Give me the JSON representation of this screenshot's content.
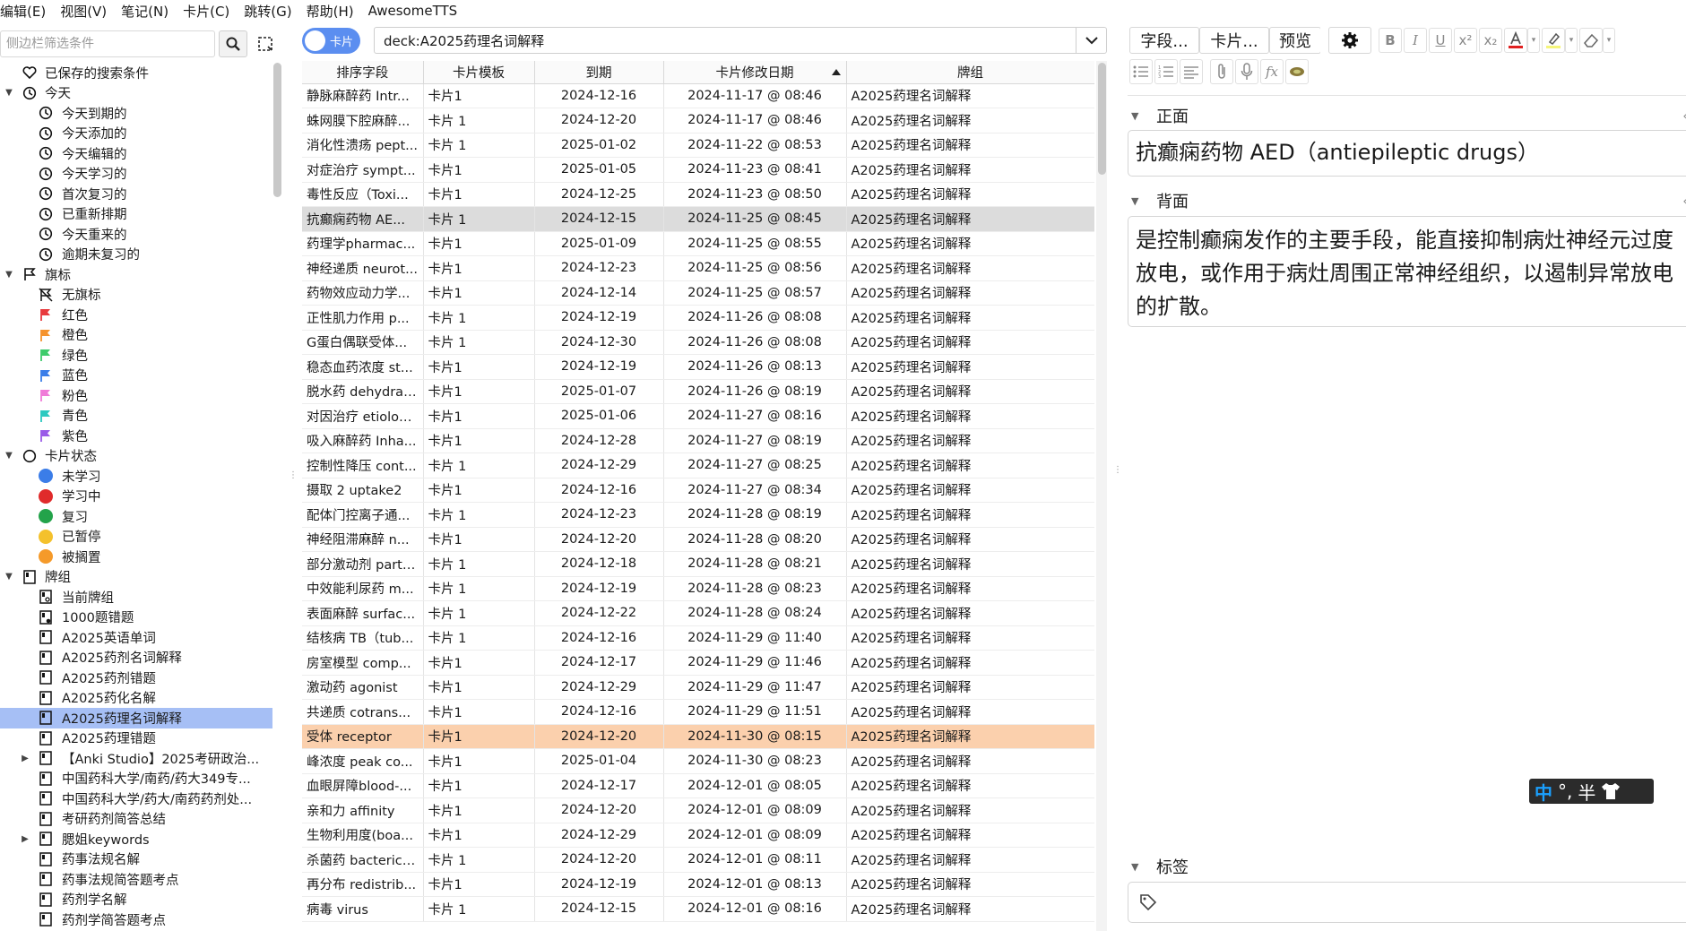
{
  "menu": [
    "编辑(E)",
    "视图(V)",
    "笔记(N)",
    "卡片(C)",
    "跳转(G)",
    "帮助(H)",
    "AwesomeTTS"
  ],
  "sidebar": {
    "search_placeholder": "侧边栏筛选条件",
    "items": [
      {
        "label": "已保存的搜索条件",
        "level": 0,
        "icon": "heart-icon",
        "expander": ""
      },
      {
        "label": "今天",
        "level": 0,
        "icon": "clock-icon",
        "expander": "open"
      },
      {
        "label": "今天到期的",
        "level": 1,
        "icon": "clock-icon",
        "expander": ""
      },
      {
        "label": "今天添加的",
        "level": 1,
        "icon": "clock-icon",
        "expander": ""
      },
      {
        "label": "今天编辑的",
        "level": 1,
        "icon": "clock-icon",
        "expander": ""
      },
      {
        "label": "今天学习的",
        "level": 1,
        "icon": "clock-icon",
        "expander": ""
      },
      {
        "label": "首次复习的",
        "level": 1,
        "icon": "clock-icon",
        "expander": ""
      },
      {
        "label": "已重新排期",
        "level": 1,
        "icon": "clock-icon",
        "expander": ""
      },
      {
        "label": "今天重来的",
        "level": 1,
        "icon": "clock-icon",
        "expander": ""
      },
      {
        "label": "逾期未复习的",
        "level": 1,
        "icon": "clock-icon",
        "expander": ""
      },
      {
        "label": "旗标",
        "level": 0,
        "icon": "flag-outline-icon",
        "expander": "open"
      },
      {
        "label": "无旗标",
        "level": 1,
        "icon": "no-flag-icon",
        "expander": ""
      },
      {
        "label": "红色",
        "level": 1,
        "icon": "flag-red-icon",
        "color": "#e8393c",
        "expander": ""
      },
      {
        "label": "橙色",
        "level": 1,
        "icon": "flag-orange-icon",
        "color": "#f5932e",
        "expander": ""
      },
      {
        "label": "绿色",
        "level": 1,
        "icon": "flag-green-icon",
        "color": "#3ecb6b",
        "expander": ""
      },
      {
        "label": "蓝色",
        "level": 1,
        "icon": "flag-blue-icon",
        "color": "#3b7de8",
        "expander": ""
      },
      {
        "label": "粉色",
        "level": 1,
        "icon": "flag-pink-icon",
        "color": "#f07ad8",
        "expander": ""
      },
      {
        "label": "青色",
        "level": 1,
        "icon": "flag-cyan-icon",
        "color": "#2bc9c0",
        "expander": ""
      },
      {
        "label": "紫色",
        "level": 1,
        "icon": "flag-purple-icon",
        "color": "#9a5be8",
        "expander": ""
      },
      {
        "label": "卡片状态",
        "level": 0,
        "icon": "circle-outline-icon",
        "expander": "open"
      },
      {
        "label": "未学习",
        "level": 1,
        "icon": "dot-blue-icon",
        "color": "#3b7de8",
        "expander": ""
      },
      {
        "label": "学习中",
        "level": 1,
        "icon": "dot-red-icon",
        "color": "#e02b2b",
        "expander": ""
      },
      {
        "label": "复习",
        "level": 1,
        "icon": "dot-green-icon",
        "color": "#23a34a",
        "expander": ""
      },
      {
        "label": "已暂停",
        "level": 1,
        "icon": "dot-yellow-icon",
        "color": "#f4c12c",
        "expander": ""
      },
      {
        "label": "被搁置",
        "level": 1,
        "icon": "dot-orange-icon",
        "color": "#f59a2a",
        "expander": ""
      },
      {
        "label": "牌组",
        "level": 0,
        "icon": "deck-icon",
        "expander": "open"
      },
      {
        "label": "当前牌组",
        "level": 1,
        "icon": "current-deck-icon",
        "expander": ""
      },
      {
        "label": "1000题错题",
        "level": 1,
        "icon": "filtered-deck-icon",
        "expander": ""
      },
      {
        "label": "A2025英语单词",
        "level": 1,
        "icon": "deck-icon",
        "expander": ""
      },
      {
        "label": "A2025药剂名词解释",
        "level": 1,
        "icon": "deck-icon",
        "expander": ""
      },
      {
        "label": "A2025药剂错题",
        "level": 1,
        "icon": "deck-icon",
        "expander": ""
      },
      {
        "label": "A2025药化名解",
        "level": 1,
        "icon": "deck-icon",
        "expander": ""
      },
      {
        "label": "A2025药理名词解释",
        "level": 1,
        "icon": "deck-icon",
        "expander": "",
        "selected": true
      },
      {
        "label": "A2025药理错题",
        "level": 1,
        "icon": "deck-icon",
        "expander": ""
      },
      {
        "label": "【Anki Studio】2025考研政治...",
        "level": 1,
        "icon": "deck-icon",
        "expander": "closed"
      },
      {
        "label": "中国药科大学/南药/药大349专...",
        "level": 1,
        "icon": "deck-icon",
        "expander": ""
      },
      {
        "label": "中国药科大学/药大/南药药剂处...",
        "level": 1,
        "icon": "deck-icon",
        "expander": ""
      },
      {
        "label": "考研药剂简答总结",
        "level": 1,
        "icon": "deck-icon",
        "expander": ""
      },
      {
        "label": "腮姐keywords",
        "level": 1,
        "icon": "deck-icon",
        "expander": "closed"
      },
      {
        "label": "药事法规名解",
        "level": 1,
        "icon": "deck-icon",
        "expander": ""
      },
      {
        "label": "药事法规简答题考点",
        "level": 1,
        "icon": "deck-icon",
        "expander": ""
      },
      {
        "label": "药剂学名解",
        "level": 1,
        "icon": "deck-icon",
        "expander": ""
      },
      {
        "label": "药剂学简答题考点",
        "level": 1,
        "icon": "deck-icon",
        "expander": ""
      }
    ]
  },
  "toolbar": {
    "toggle_label": "卡片",
    "search_value": "deck:A2025药理名词解释"
  },
  "table": {
    "columns": [
      "排序字段",
      "卡片模板",
      "到期",
      "卡片修改日期",
      "牌组"
    ],
    "sorted_column": "卡片修改日期",
    "rows": [
      [
        "静脉麻醉药 Intr...",
        "卡片1",
        "2024-12-16",
        "2024-11-17 @ 08:46",
        "A2025药理名词解释"
      ],
      [
        "蛛网膜下腔麻醉...",
        "卡片 1",
        "2024-12-20",
        "2024-11-17 @ 08:46",
        "A2025药理名词解释"
      ],
      [
        "消化性溃疡 pept...",
        "卡片 1",
        "2025-01-02",
        "2024-11-22 @ 08:53",
        "A2025药理名词解释"
      ],
      [
        "对症治疗 sympt...",
        "卡片1",
        "2025-01-05",
        "2024-11-23 @ 08:41",
        "A2025药理名词解释"
      ],
      [
        "毒性反应（Toxi...",
        "卡片1",
        "2024-12-25",
        "2024-11-23 @ 08:50",
        "A2025药理名词解释"
      ],
      [
        "抗癫痫药物 AE...",
        "卡片 1",
        "2024-12-15",
        "2024-11-25 @ 08:45",
        "A2025药理名词解释"
      ],
      [
        "药理学pharmac...",
        "卡片1",
        "2025-01-09",
        "2024-11-25 @ 08:55",
        "A2025药理名词解释"
      ],
      [
        "神经递质 neurot...",
        "卡片1",
        "2024-12-23",
        "2024-11-25 @ 08:56",
        "A2025药理名词解释"
      ],
      [
        "药物效应动力学...",
        "卡片1",
        "2024-12-14",
        "2024-11-25 @ 08:57",
        "A2025药理名词解释"
      ],
      [
        "正性肌力作用 p...",
        "卡片 1",
        "2024-12-19",
        "2024-11-26 @ 08:08",
        "A2025药理名词解释"
      ],
      [
        "G蛋白偶联受体...",
        "卡片 1",
        "2024-12-30",
        "2024-11-26 @ 08:08",
        "A2025药理名词解释"
      ],
      [
        "稳态血药浓度 st...",
        "卡片1",
        "2024-12-19",
        "2024-11-26 @ 08:13",
        "A2025药理名词解释"
      ],
      [
        "脱水药 dehydrat...",
        "卡片1",
        "2025-01-07",
        "2024-11-26 @ 08:19",
        "A2025药理名词解释"
      ],
      [
        "对因治疗 etiolog...",
        "卡片1",
        "2025-01-06",
        "2024-11-27 @ 08:16",
        "A2025药理名词解释"
      ],
      [
        "吸入麻醉药 Inha...",
        "卡片1",
        "2024-12-28",
        "2024-11-27 @ 08:19",
        "A2025药理名词解释"
      ],
      [
        "控制性降压 cont...",
        "卡片 1",
        "2024-12-29",
        "2024-11-27 @ 08:25",
        "A2025药理名词解释"
      ],
      [
        "摄取 2 uptake2",
        "卡片1",
        "2024-12-16",
        "2024-11-27 @ 08:34",
        "A2025药理名词解释"
      ],
      [
        "配体门控离子通...",
        "卡片 1",
        "2024-12-23",
        "2024-11-28 @ 08:19",
        "A2025药理名词解释"
      ],
      [
        "神经阻滞麻醉 n...",
        "卡片1",
        "2024-12-20",
        "2024-11-28 @ 08:20",
        "A2025药理名词解释"
      ],
      [
        "部分激动剂 parti...",
        "卡片 1",
        "2024-12-18",
        "2024-11-28 @ 08:21",
        "A2025药理名词解释"
      ],
      [
        "中效能利尿药 m...",
        "卡片 1",
        "2024-12-19",
        "2024-11-28 @ 08:23",
        "A2025药理名词解释"
      ],
      [
        "表面麻醉 surfac...",
        "卡片 1",
        "2024-12-22",
        "2024-11-28 @ 08:24",
        "A2025药理名词解释"
      ],
      [
        "结核病 TB（tub...",
        "卡片 1",
        "2024-12-16",
        "2024-11-29 @ 11:40",
        "A2025药理名词解释"
      ],
      [
        "房室模型 comp...",
        "卡片1",
        "2024-12-17",
        "2024-11-29 @ 11:46",
        "A2025药理名词解释"
      ],
      [
        "激动药 agonist",
        "卡片1",
        "2024-12-29",
        "2024-11-29 @ 11:47",
        "A2025药理名词解释"
      ],
      [
        "共递质 cotrans...",
        "卡片1",
        "2024-12-16",
        "2024-11-29 @ 11:51",
        "A2025药理名词解释"
      ],
      [
        "受体 receptor",
        "卡片1",
        "2024-12-20",
        "2024-11-30 @ 08:15",
        "A2025药理名词解释"
      ],
      [
        "峰浓度 peak co...",
        "卡片1",
        "2025-01-04",
        "2024-11-30 @ 08:23",
        "A2025药理名词解释"
      ],
      [
        "血眼屏障blood-...",
        "卡片1",
        "2024-12-17",
        "2024-12-01 @ 08:05",
        "A2025药理名词解释"
      ],
      [
        "亲和力 affinity",
        "卡片1",
        "2024-12-20",
        "2024-12-01 @ 08:09",
        "A2025药理名词解释"
      ],
      [
        "生物利用度(boa...",
        "卡片1",
        "2024-12-29",
        "2024-12-01 @ 08:09",
        "A2025药理名词解释"
      ],
      [
        "杀菌药 bacterici...",
        "卡片 1",
        "2024-12-20",
        "2024-12-01 @ 08:11",
        "A2025药理名词解释"
      ],
      [
        "再分布 redistrib...",
        "卡片1",
        "2024-12-19",
        "2024-12-01 @ 08:13",
        "A2025药理名词解释"
      ],
      [
        "病毒 virus",
        "卡片 1",
        "2024-12-15",
        "2024-12-01 @ 08:16",
        "A2025药理名词解释"
      ]
    ],
    "current_row": 5,
    "marked_row": 26,
    "current_color": "#dcdcdc",
    "marked_color": "#fbd0ad"
  },
  "editor": {
    "fields_button": "字段...",
    "cards_button": "卡片...",
    "preview_button": "预览",
    "front_label": "正面",
    "front_value": "抗癫痫药物 AED（antiepileptic drugs）",
    "back_label": "背面",
    "back_value": "是控制癫痫发作的主要手段，能直接抑制病灶神经元过度放电，或作用于病灶周围正常神经组织，以遏制异常放电的扩散。",
    "tags_label": "标签"
  },
  "ime": {
    "mode": "中",
    "punct": "°,",
    "width": "半"
  },
  "colors": {
    "accent": "#5b8ef0",
    "sidebar_selected": "#a6bff5",
    "text_color_swatch": "#e02020",
    "highlight_swatch": "#f5f57a"
  }
}
